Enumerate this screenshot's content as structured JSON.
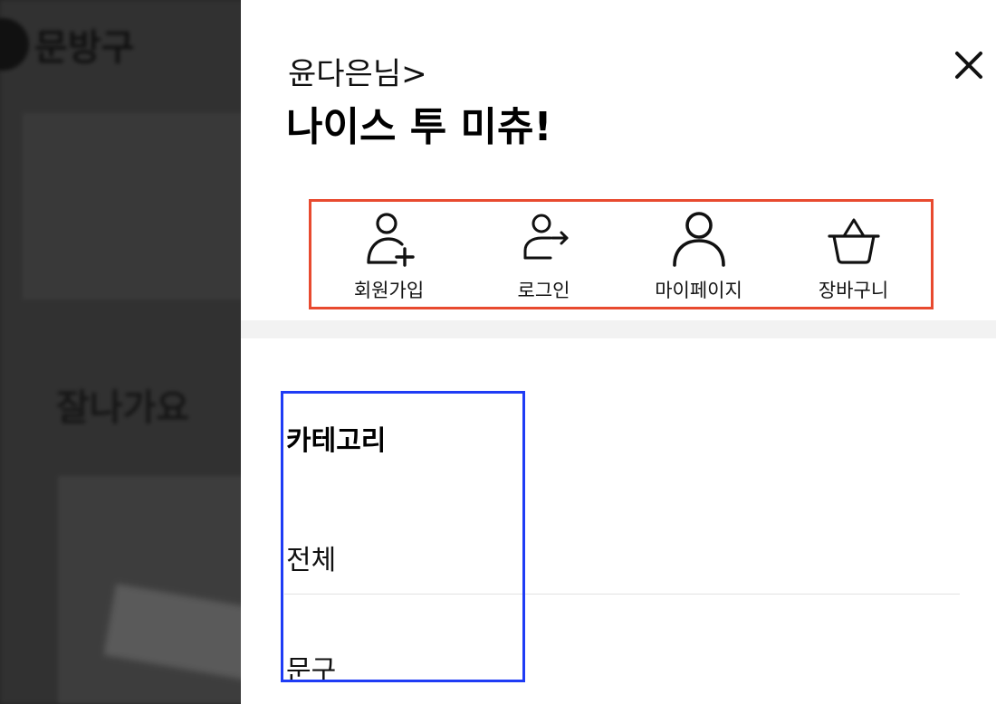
{
  "background": {
    "logo_text": "문방구",
    "heading": "잘나가요"
  },
  "drawer": {
    "greeting": "윤다은님>",
    "headline": "나이스 투 미츄!",
    "close_icon": "close-icon",
    "quick_menu": {
      "border_color": "#e84a2f",
      "items": [
        {
          "label": "회원가입",
          "icon": "user-add-icon"
        },
        {
          "label": "로그인",
          "icon": "login-icon"
        },
        {
          "label": "마이페이지",
          "icon": "user-icon"
        },
        {
          "label": "장바구니",
          "icon": "basket-icon"
        }
      ]
    },
    "category": {
      "border_color": "#1f3cf5",
      "title": "카테고리",
      "items": [
        "전체",
        "문구"
      ]
    }
  }
}
